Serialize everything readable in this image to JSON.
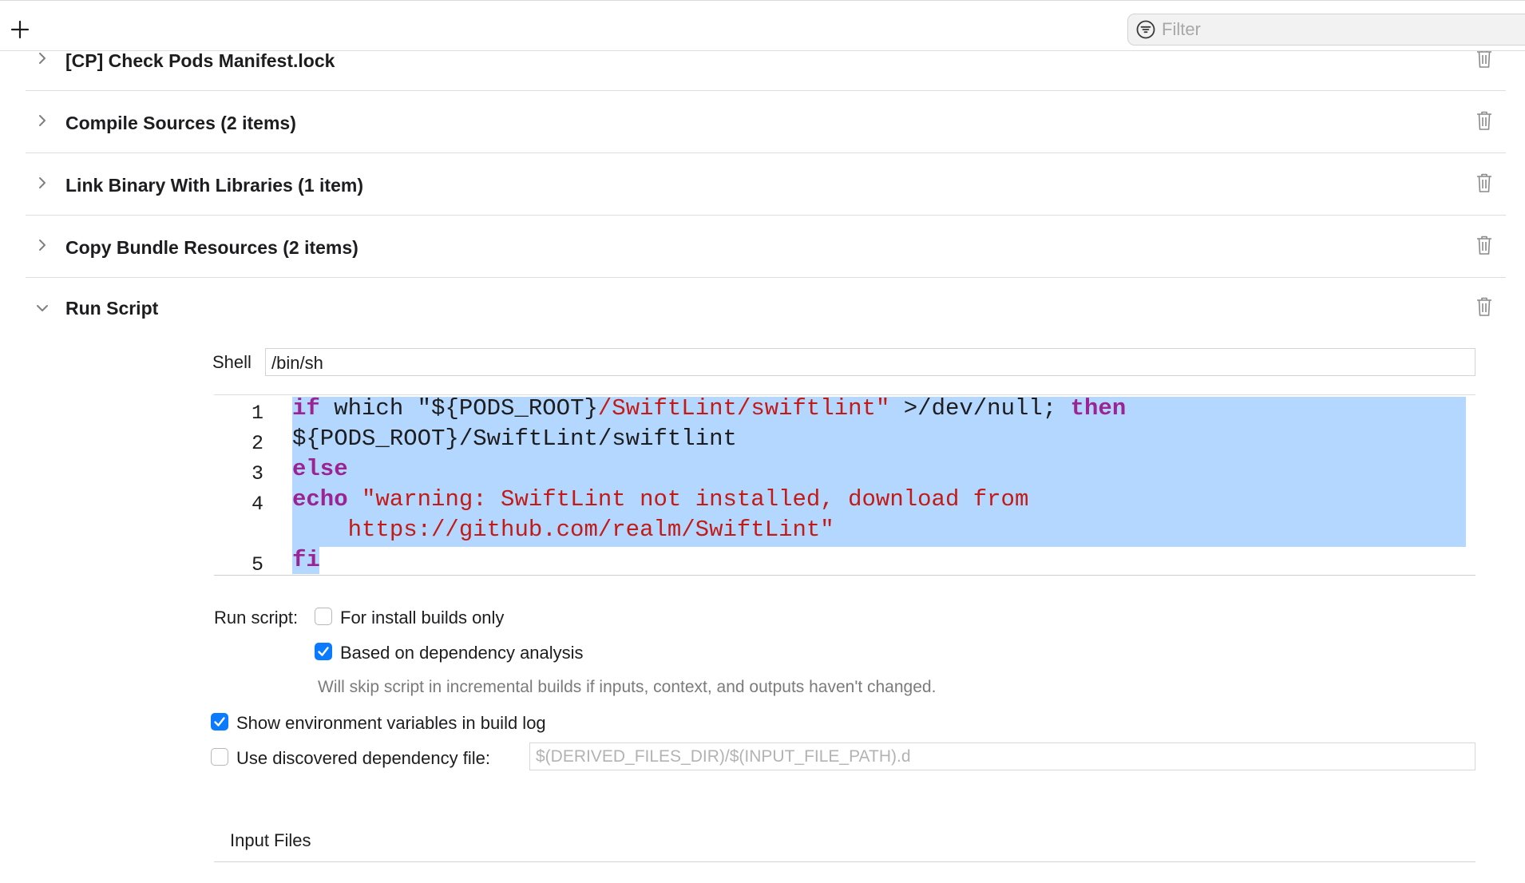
{
  "toolbar": {
    "add_icon": "plus-icon",
    "filter_placeholder": "Filter",
    "filter_icon": "filter-icon"
  },
  "phases": [
    {
      "title": "[CP] Check Pods Manifest.lock",
      "expanded": false
    },
    {
      "title": "Compile Sources (2 items)",
      "expanded": false
    },
    {
      "title": "Link Binary With Libraries (1 item)",
      "expanded": false
    },
    {
      "title": "Copy Bundle Resources (2 items)",
      "expanded": false
    }
  ],
  "run_script": {
    "title": "Run Script",
    "expanded": true,
    "shell_label": "Shell",
    "shell_value": "/bin/sh",
    "code": {
      "line_numbers": [
        "1",
        "2",
        "3",
        "4",
        "5"
      ],
      "line1": {
        "kw_if": "if",
        "plain_which": " which ",
        "str_part1": "\"${PODS_ROOT}",
        "str_part2": "/SwiftLint/swiftlint\"",
        "plain_redirect": " >/dev/null; ",
        "kw_then": "then"
      },
      "line2": "${PODS_ROOT}/SwiftLint/swiftlint",
      "line3": {
        "kw_else": "else"
      },
      "line4": {
        "kw_echo": "echo",
        "str_a": " \"warning: SwiftLint not installed, download from",
        "str_b": "    https://github.com/realm/SwiftLint\""
      },
      "line5": {
        "kw_fi": "fi"
      },
      "selection_color": "#b3d7ff",
      "keyword_color": "#9b2393",
      "string_color": "#c41a16"
    },
    "run_script_label": "Run script:",
    "install_builds_only": {
      "label": "For install builds only",
      "checked": false
    },
    "dependency_analysis": {
      "label": "Based on dependency analysis",
      "checked": true
    },
    "dependency_hint": "Will skip script in incremental builds if inputs, context, and outputs haven't changed.",
    "show_env_vars": {
      "label": "Show environment variables in build log",
      "checked": true
    },
    "use_dep_file": {
      "label": "Use discovered dependency file:",
      "checked": false,
      "placeholder": "$(DERIVED_FILES_DIR)/$(INPUT_FILE_PATH).d"
    },
    "input_files_label": "Input Files"
  },
  "accent_color": "#0a7aff"
}
